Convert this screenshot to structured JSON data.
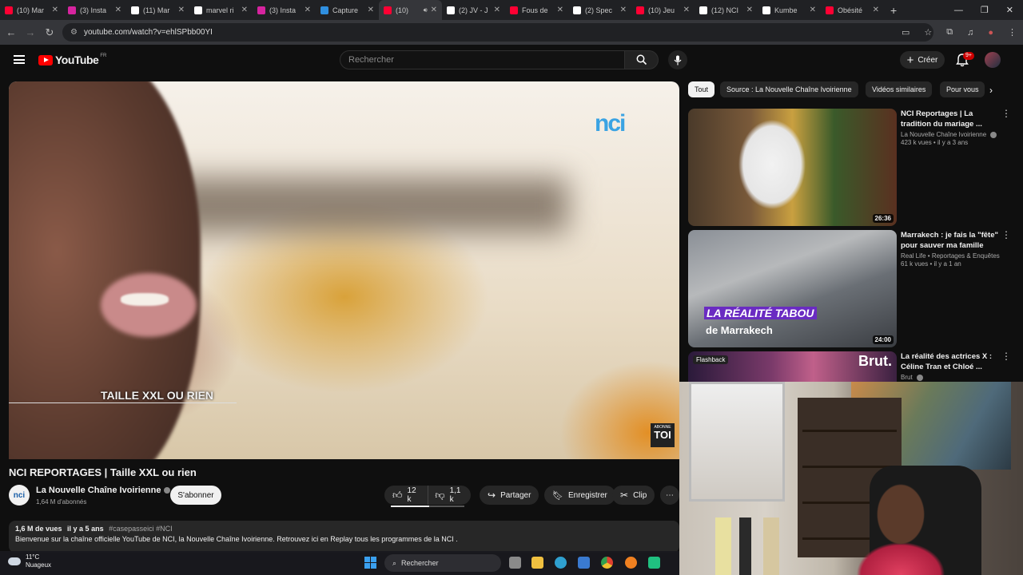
{
  "browser": {
    "tabs": [
      {
        "title": "(10) Mar",
        "favicon": "youtube-icon",
        "color": "#ff0033"
      },
      {
        "title": "(3) Insta",
        "favicon": "instagram-icon",
        "color": "#d6249f"
      },
      {
        "title": "(11) Mar",
        "favicon": "x-icon",
        "color": "#ffffff"
      },
      {
        "title": "marvel ri",
        "favicon": "tiktok-icon",
        "color": "#ffffff"
      },
      {
        "title": "(3) Insta",
        "favicon": "instagram-icon",
        "color": "#d6249f"
      },
      {
        "title": "Capture",
        "favicon": "capture-icon",
        "color": "#2f8fe0"
      },
      {
        "title": "(10)",
        "favicon": "youtube-icon",
        "color": "#ff0033",
        "active": true
      },
      {
        "title": "(2) JV - J",
        "favicon": "x-icon",
        "color": "#ffffff"
      },
      {
        "title": "Fous de",
        "favicon": "youtube-icon",
        "color": "#ff0033"
      },
      {
        "title": "(2) Spec",
        "favicon": "x-icon",
        "color": "#ffffff"
      },
      {
        "title": "(10) Jeu",
        "favicon": "youtube-icon",
        "color": "#ff0033"
      },
      {
        "title": "(12) NCI",
        "favicon": "x-icon",
        "color": "#ffffff"
      },
      {
        "title": "Kumbe",
        "favicon": "x-icon",
        "color": "#ffffff"
      },
      {
        "title": "Obésité",
        "favicon": "youtube-icon",
        "color": "#ff0033"
      }
    ],
    "url": "youtube.com/watch?v=ehlSPbb00YI"
  },
  "youtube": {
    "logo_text": "YouTube",
    "region": "FR",
    "search_placeholder": "Rechercher",
    "create_label": "Créer",
    "notif_count": "9+"
  },
  "video": {
    "caption": "TAILLE XXL OU RIEN",
    "watermark": "nci",
    "corner_badge_top": "ABONNE",
    "corner_badge_main": "TOI",
    "title": "NCI REPORTAGES | Taille XXL ou rien",
    "channel": "La Nouvelle Chaîne Ivoirienne",
    "channel_avatar_text": "nci",
    "subscribers": "1,64 M d'abonnés",
    "subscribe_label": "S'abonner",
    "likes": "12 k",
    "dislikes": "1,1 k",
    "like_ratio": 0.52,
    "share_label": "Partager",
    "save_label": "Enregistrer",
    "clip_label": "Clip",
    "description": {
      "views": "1,6 M de vues",
      "age": "il y a 5 ans",
      "tags": "#casepasseici #NCI",
      "text": "Bienvenue sur la chaîne officielle YouTube de NCI, la Nouvelle Chaîne Ivoirienne.  Retrouvez ici en Replay tous les programmes de la NCI ."
    }
  },
  "chips": [
    "Tout",
    "Source : La Nouvelle Chaîne Ivoirienne",
    "Vidéos similaires",
    "Pour vous"
  ],
  "recommendations": [
    {
      "title": "NCI Reportages | La tradition du mariage ...",
      "channel": "La Nouvelle Chaîne Ivoirienne",
      "verified": true,
      "meta": "423 k vues • il y a 3 ans",
      "duration": "26:36"
    },
    {
      "title": "Marrakech : je fais la \"fête\" pour sauver ma famille",
      "channel": "Real Life • Reportages & Enquêtes",
      "verified": false,
      "meta": "61 k vues • il y a 1 an",
      "duration": "24:00",
      "thumb_line1": "LA RÉALITÉ TABOU",
      "thumb_line2": "de Marrakech"
    },
    {
      "title": "La réalité des actrices X : Céline Tran et Chloé ...",
      "channel": "Brut",
      "verified": true,
      "meta": "",
      "duration": "",
      "thumb_badge": "Flashback",
      "thumb_brand": "Brut."
    }
  ],
  "taskbar": {
    "temperature": "11°C",
    "weather": "Nuageux",
    "search_label": "Rechercher"
  }
}
